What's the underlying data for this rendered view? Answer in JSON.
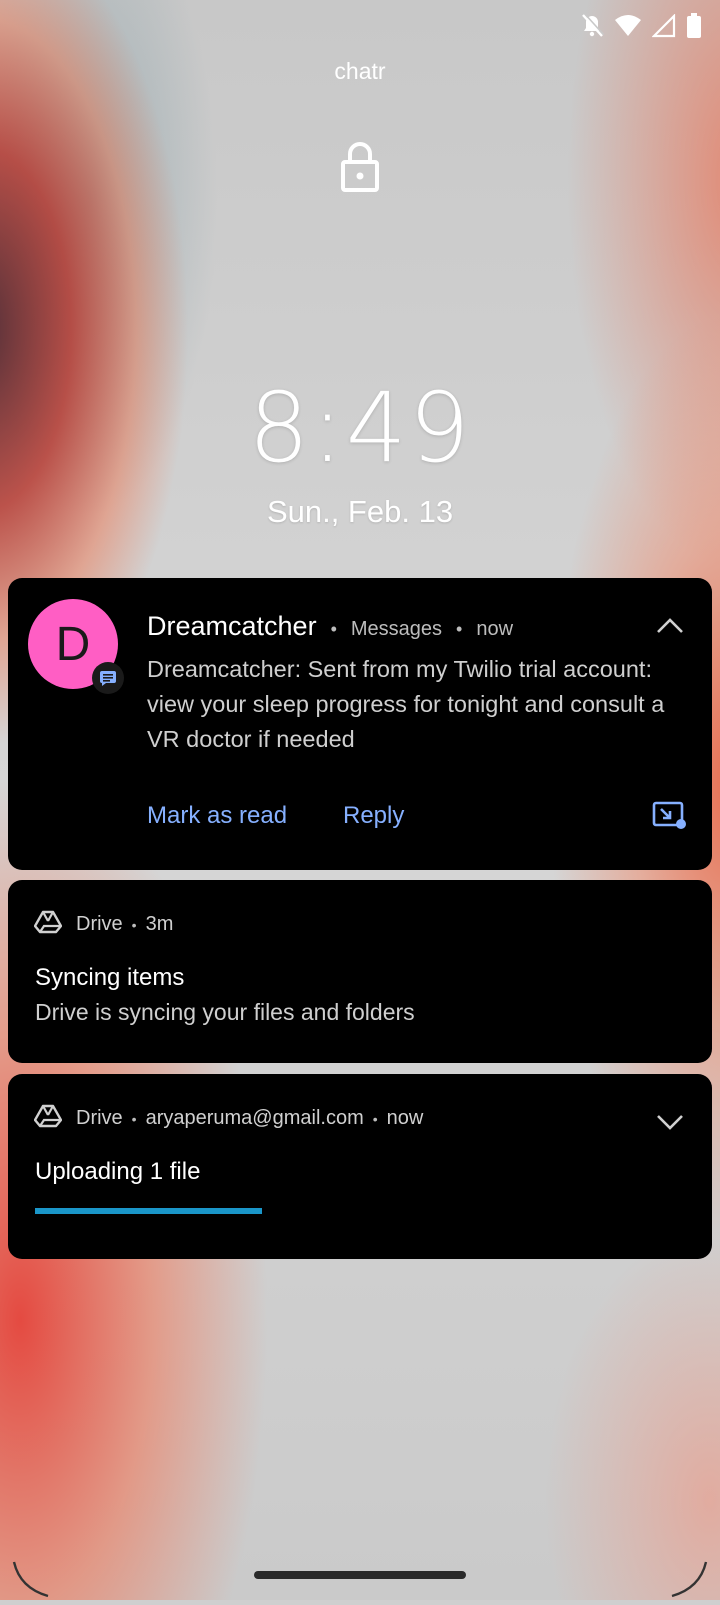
{
  "status_bar": {
    "icons": [
      "notifications-off-icon",
      "wifi-icon",
      "cell-signal-icon",
      "battery-icon"
    ]
  },
  "carrier": "chatr",
  "lock_icon": "lock-icon",
  "clock": {
    "time": "8:49",
    "date": "Sun., Feb. 13"
  },
  "notifications": [
    {
      "avatar_letter": "D",
      "avatar_color": "#ff5ec4",
      "sender": "Dreamcatcher",
      "app": "Messages",
      "time": "now",
      "body": "Dreamcatcher: Sent from my Twilio trial account: view your sleep progress for tonight and consult a VR doctor if needed",
      "actions": [
        "Mark as read",
        "Reply"
      ],
      "collapse_icon": "chevron-up-icon",
      "bubble_icon": "picture-in-picture-icon"
    },
    {
      "app": "Drive",
      "time": "3m",
      "title": "Syncing items",
      "text": "Drive is syncing your files and folders"
    },
    {
      "app": "Drive",
      "account": "aryaperuma@gmail.com",
      "time": "now",
      "title": "Uploading 1 file",
      "progress": 0.35,
      "progress_color": "#1a96c9",
      "expand_icon": "chevron-down-icon"
    }
  ],
  "accent_link_color": "#86b0ff"
}
